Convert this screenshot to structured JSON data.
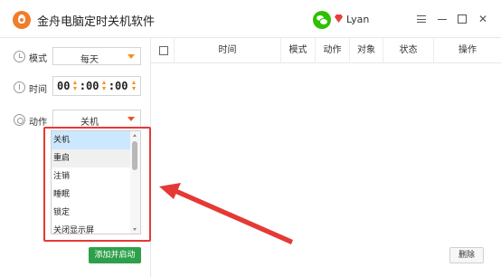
{
  "app": {
    "title": "金舟电脑定时关机软件",
    "user_name": "Lyan"
  },
  "form": {
    "mode": {
      "label": "模式",
      "value": "每天"
    },
    "time": {
      "label": "时间",
      "hour": "00",
      "minute": "00",
      "second": "00"
    },
    "action": {
      "label": "动作",
      "value": "关机",
      "options": [
        "关机",
        "重启",
        "注销",
        "睡眠",
        "锁定",
        "关闭显示屏"
      ],
      "selected_index": 0,
      "hovered_index": 1
    },
    "add_button": "添加并启动"
  },
  "table": {
    "columns": [
      "时间",
      "模式",
      "动作",
      "对象",
      "状态",
      "操作"
    ],
    "rows": []
  },
  "delete_button": "删除",
  "colors": {
    "accent_orange": "#f29220",
    "primary_green": "#2ea04a",
    "annotation_red": "#e53935",
    "selection_blue": "#cce8ff"
  }
}
